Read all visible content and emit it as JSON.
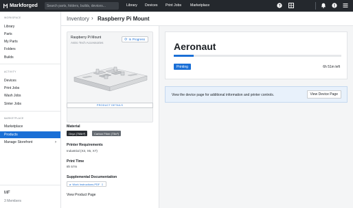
{
  "topbar": {
    "brand": "Markforged",
    "search_placeholder": "Search parts, folders, builds, devices...",
    "nav": [
      "Library",
      "Devices",
      "Print Jobs",
      "Marketplace"
    ]
  },
  "sidebar": {
    "section_workspace": "WORKSPACE",
    "workspace_items": [
      "Library",
      "Parts",
      "My Parts",
      "Folders",
      "Builds"
    ],
    "section_activity": "ACTIVITY",
    "activity_items": [
      "Devices",
      "Print Jobs",
      "Wash Jobs",
      "Sinter Jobs"
    ],
    "section_marketplace": "MARKETPLACE",
    "marketplace_items": [
      "Marketplace",
      "Products",
      "Manage Storefront"
    ],
    "org_initials": "MF",
    "org_members": "3 Members"
  },
  "breadcrumb": {
    "parent": "Inventory",
    "separator": "›",
    "current": "Raspberry Pi Mount"
  },
  "product": {
    "name": "Raspberry Pi Mount",
    "vendor": "Astro Tech Accessories",
    "status": "In Progress",
    "details_button": "PRODUCT DETAILS",
    "material_label": "Material",
    "materials": [
      "Onyx (758in³)",
      "Carbon Fiber (73in³)"
    ],
    "requirements_label": "Printer Requirements",
    "requirements": "Industrial (X3, X5, X7)",
    "print_time_label": "Print Time",
    "print_time": "8h 57m",
    "docs_label": "Supplemental Documentation",
    "doc_link": "Work Instructions.PDF",
    "view_page": "View Product Page"
  },
  "device": {
    "name": "Aeronaut",
    "status": "Printing",
    "time_left": "6h 51m left",
    "progress_percent": 12,
    "info_text": "View the device page for additional information and printer controls.",
    "info_button": "View Device Page"
  },
  "colors": {
    "accent": "#1a6fd6",
    "topbar": "#24282d"
  }
}
